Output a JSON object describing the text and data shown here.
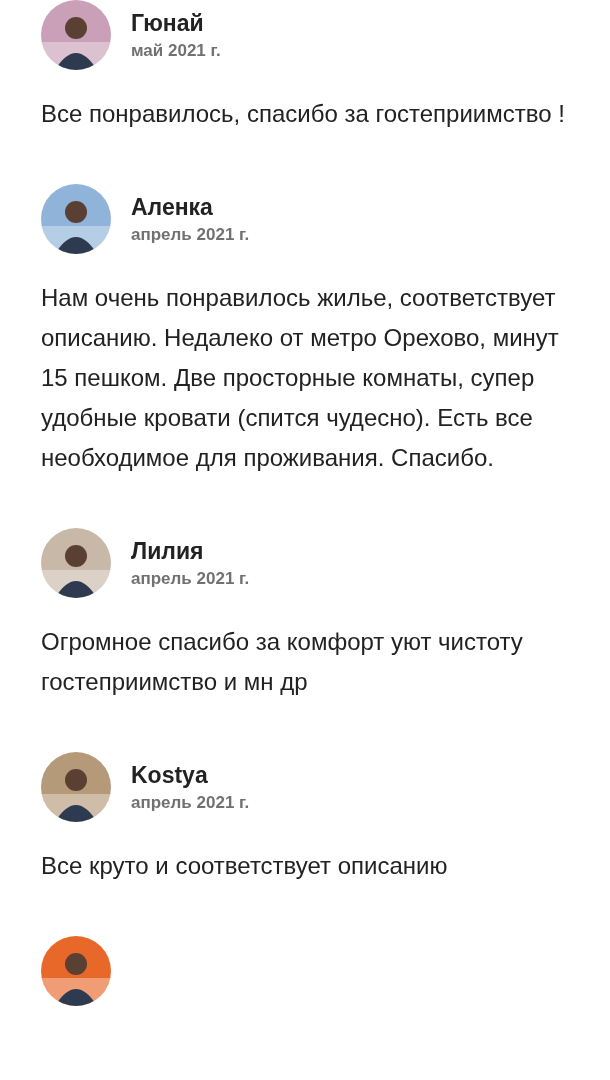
{
  "reviews": [
    {
      "name": "Гюнай",
      "date": "май 2021 г.",
      "text": "Все понравилось, спасибо за гостеприимство !"
    },
    {
      "name": "Аленка",
      "date": "апрель 2021 г.",
      "text": "Нам очень понравилось жилье, соответствует описанию. Недалеко от метро Орехово, минут 15 пешком. Две просторные комнаты, супер удобные кровати (спится чудесно). Есть все необходимое для проживания. Спасибо."
    },
    {
      "name": "Лилия",
      "date": "апрель 2021 г.",
      "text": "Огромное спасибо за комфорт уют чистоту гостеприимство и мн др"
    },
    {
      "name": "Kostya",
      "date": "апрель 2021 г.",
      "text": "Все круто и соответствует описанию"
    }
  ]
}
